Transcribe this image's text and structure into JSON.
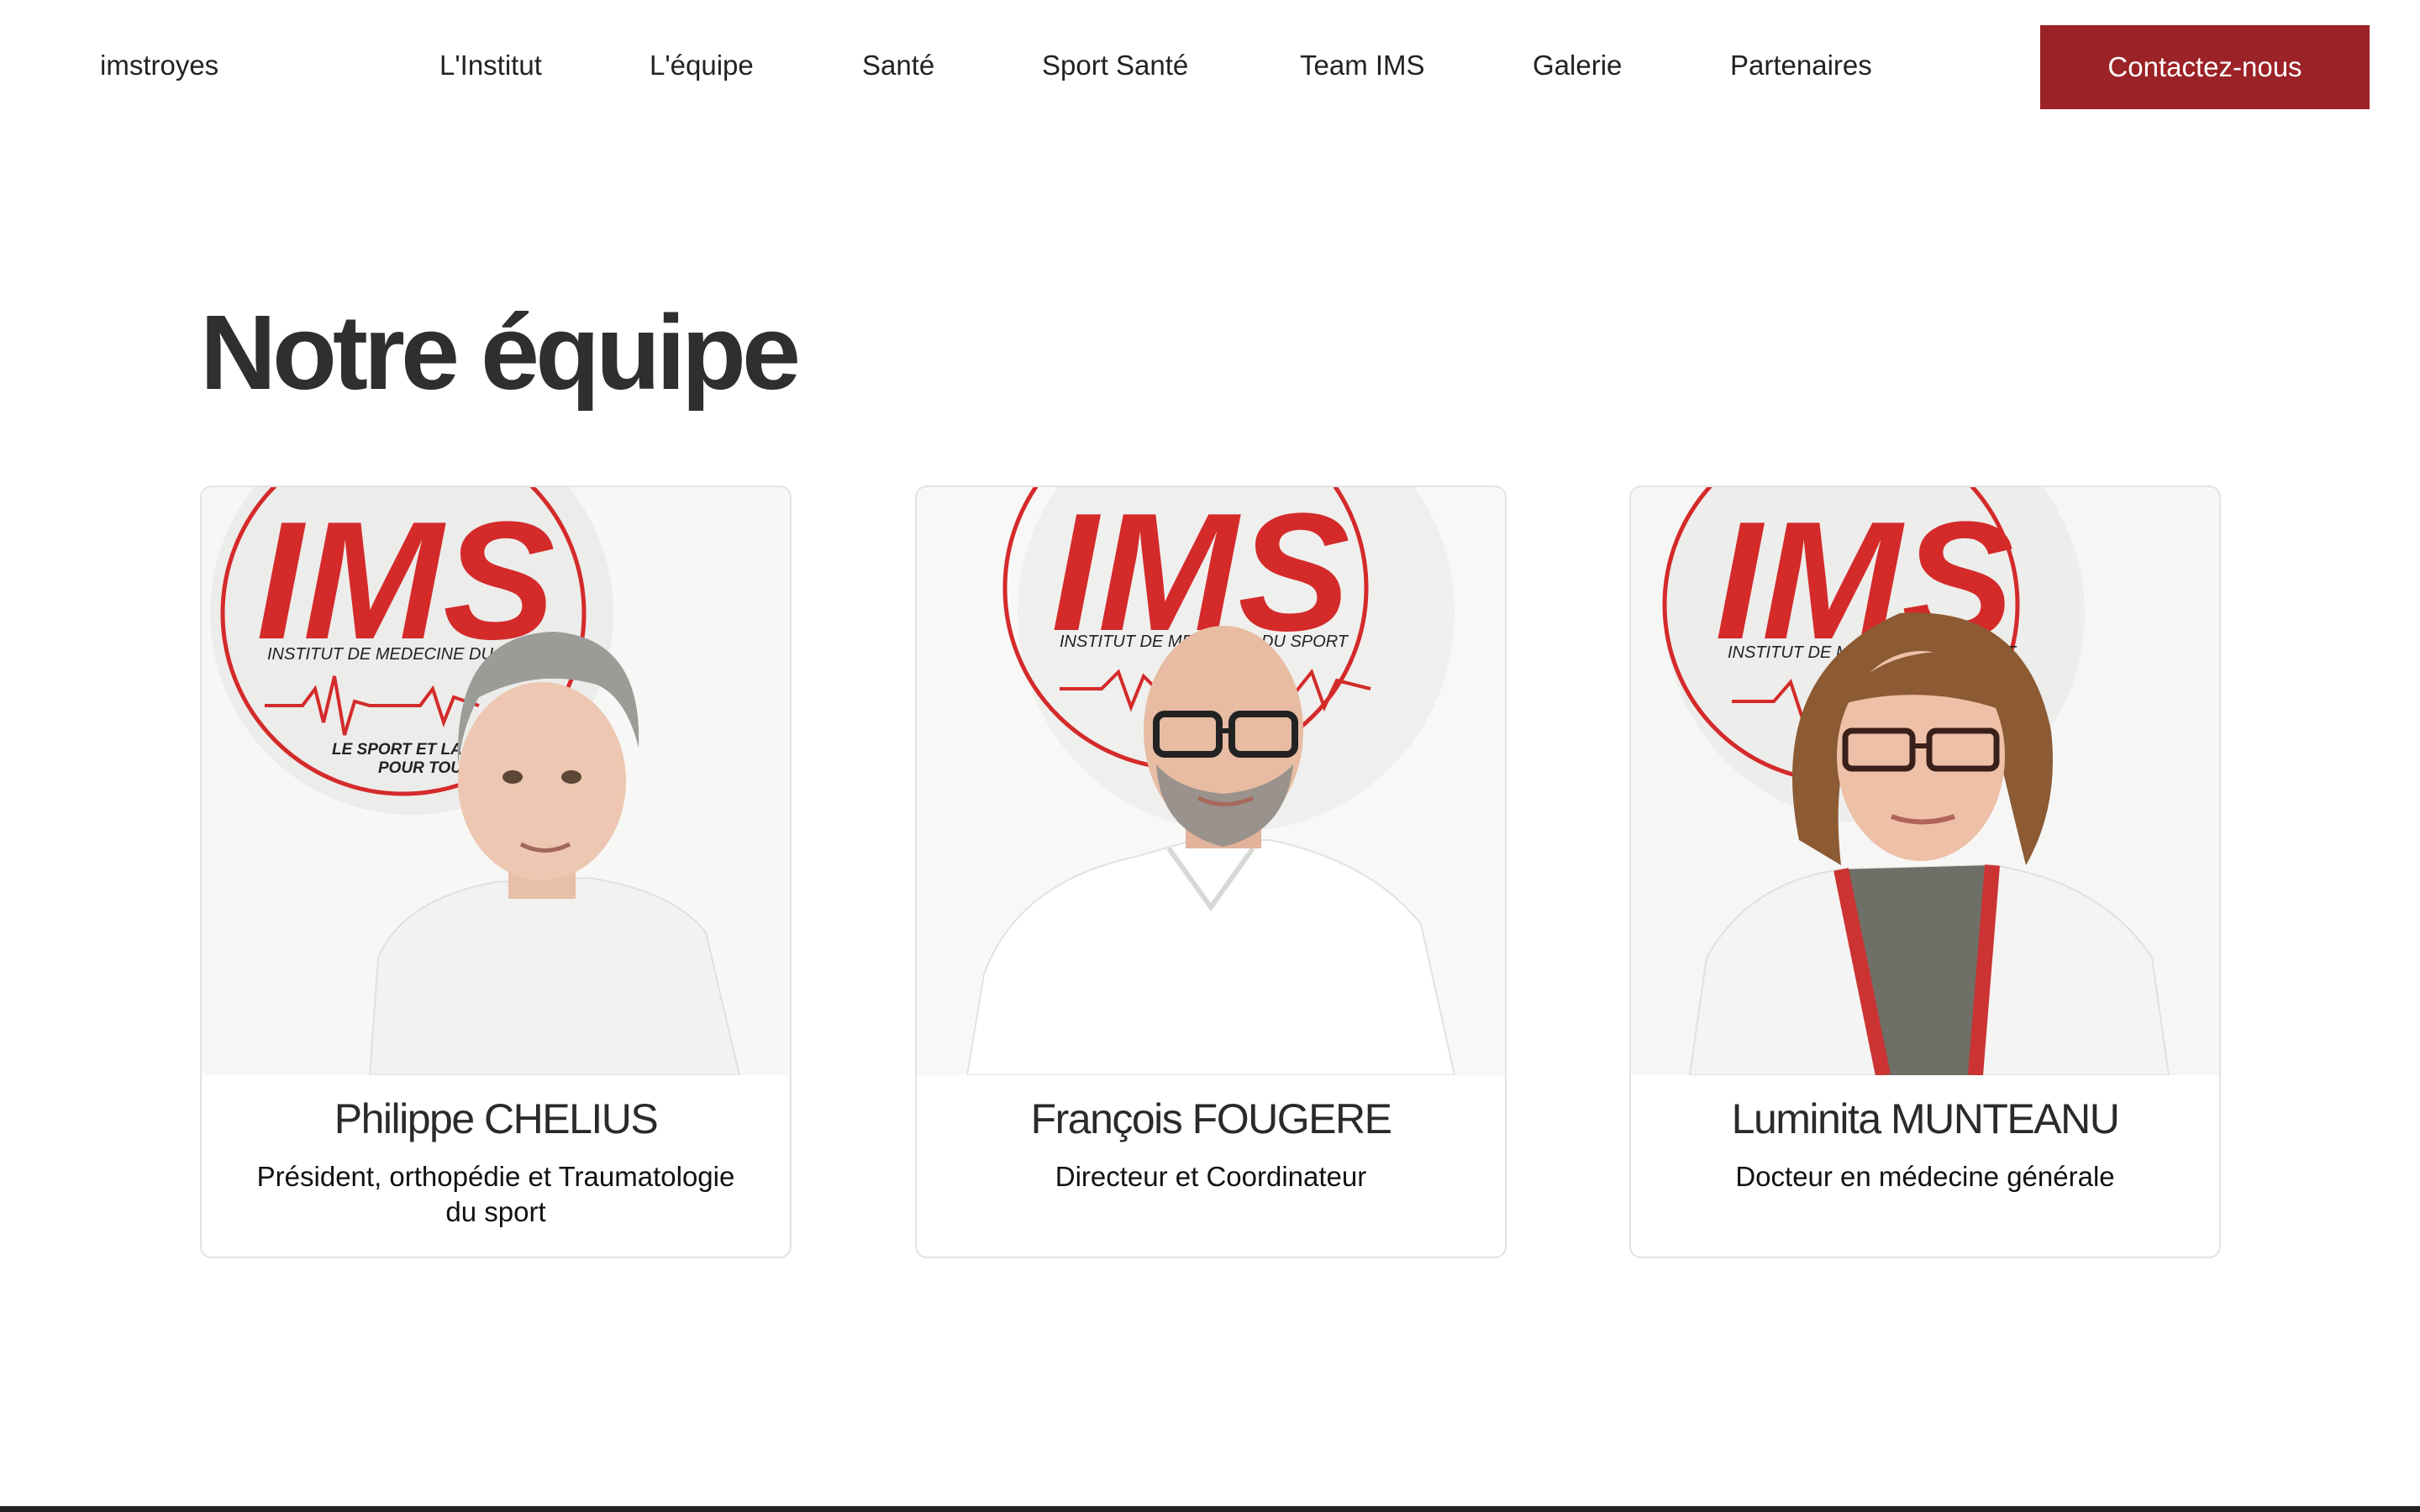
{
  "header": {
    "brand": "imstroyes",
    "nav": [
      "L'Institut",
      "L'équipe",
      "Santé",
      "Sport Santé",
      "Team IMS",
      "Galerie",
      "Partenaires"
    ],
    "cta_label": "Contactez-nous"
  },
  "section": {
    "title": "Notre équipe"
  },
  "logo": {
    "big_text": "IMS",
    "subtitle": "INSTITUT DE MEDECINE DU SPORT",
    "tagline_1": "LE SPORT ET LA SANTÉ",
    "tagline_2": "POUR TOUS"
  },
  "members": [
    {
      "name": "Philippe CHELIUS",
      "role": "Président, orthopédie et Traumatologie du sport"
    },
    {
      "name": "François FOUGERE",
      "role": "Directeur et Coordinateur"
    },
    {
      "name": "Luminita MUNTEANU",
      "role": "Docteur en médecine générale"
    }
  ],
  "colors": {
    "accent": "#9b2226",
    "logo_red": "#d42a2a",
    "text_dark": "#2f2f2f"
  }
}
